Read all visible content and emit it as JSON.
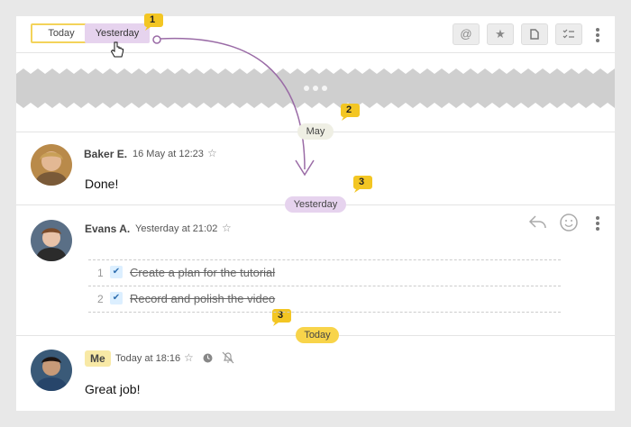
{
  "toolbar": {
    "today_label": "Today",
    "yesterday_label": "Yesterday",
    "icons": [
      "at-icon",
      "star-icon",
      "file-icon",
      "checklist-icon",
      "more-icon"
    ]
  },
  "badges": {
    "b1": "1",
    "b2": "2",
    "b3": "3"
  },
  "date_pills": {
    "may": "May",
    "yesterday": "Yesterday",
    "today": "Today"
  },
  "messages": [
    {
      "author": "Baker E.",
      "meta": "16 May at 12:23",
      "text": "Done!"
    },
    {
      "author": "Evans A.",
      "meta": "Yesterday at 21:02",
      "tasks": [
        {
          "num": "1",
          "text": "Create a plan for the tutorial"
        },
        {
          "num": "2",
          "text": "Record and polish the video"
        }
      ]
    },
    {
      "author": "Me",
      "meta": "Today at 18:16",
      "text": "Great job!"
    }
  ],
  "colors": {
    "accent_yellow": "#f3c623",
    "yesterday_purple": "#e6d3ee",
    "arrow": "#9a6ba6"
  }
}
